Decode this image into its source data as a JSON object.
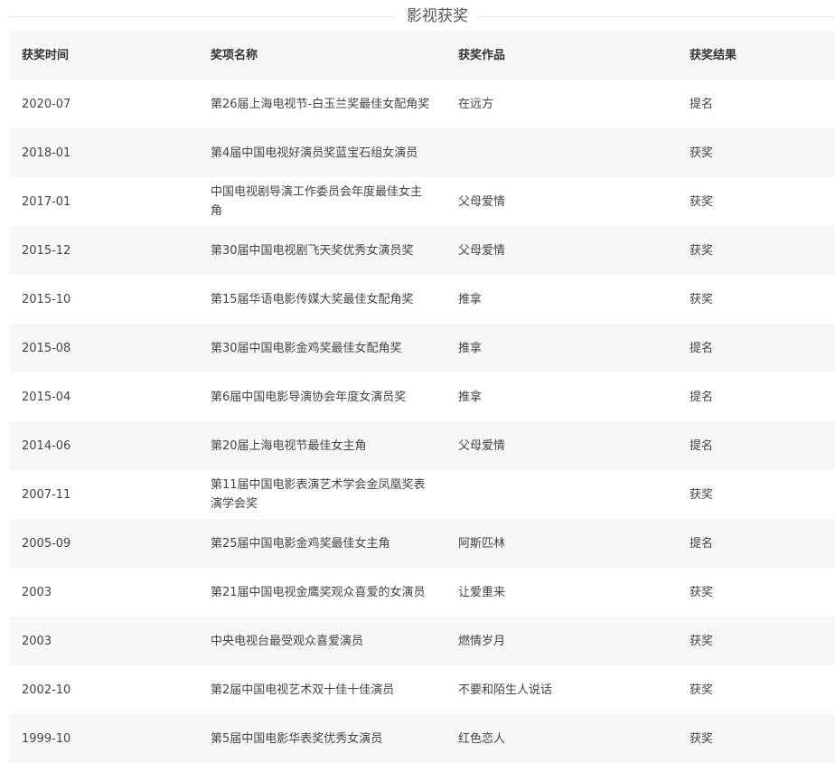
{
  "section": {
    "title": "影视获奖"
  },
  "table": {
    "headers": [
      "获奖时间",
      "奖项名称",
      "获奖作品",
      "获奖结果"
    ],
    "rows": [
      [
        "2020-07",
        "第26届上海电视节-白玉兰奖最佳女配角奖",
        "在远方",
        "提名"
      ],
      [
        "2018-01",
        "第4届中国电视好演员奖蓝宝石组女演员",
        "",
        "获奖"
      ],
      [
        "2017-01",
        "中国电视剧导演工作委员会年度最佳女主角",
        "父母爱情",
        "获奖"
      ],
      [
        "2015-12",
        "第30届中国电视剧飞天奖优秀女演员奖",
        "父母爱情",
        "获奖"
      ],
      [
        "2015-10",
        "第15届华语电影传媒大奖最佳女配角奖",
        "推拿",
        "获奖"
      ],
      [
        "2015-08",
        "第30届中国电影金鸡奖最佳女配角奖",
        "推拿",
        "提名"
      ],
      [
        "2015-04",
        "第6届中国电影导演协会年度女演员奖",
        "推拿",
        "提名"
      ],
      [
        "2014-06",
        "第20届上海电视节最佳女主角",
        "父母爱情",
        "提名"
      ],
      [
        "2007-11",
        "第11届中国电影表演艺术学会金凤凰奖表演学会奖",
        "",
        "获奖"
      ],
      [
        "2005-09",
        "第25届中国电影金鸡奖最佳女主角",
        "阿斯匹林",
        "提名"
      ],
      [
        "2003",
        "第21届中国电视金鹰奖观众喜爱的女演员",
        "让爱重来",
        "获奖"
      ],
      [
        "2003",
        "中央电视台最受观众喜爱演员",
        "燃情岁月",
        "获奖"
      ],
      [
        "2002-10",
        "第2届中国电视艺术双十佳十佳演员",
        "不要和陌生人说话",
        "获奖"
      ],
      [
        "1999-10",
        "第5届中国电影华表奖优秀女演员",
        "红色恋人",
        "获奖"
      ]
    ]
  }
}
